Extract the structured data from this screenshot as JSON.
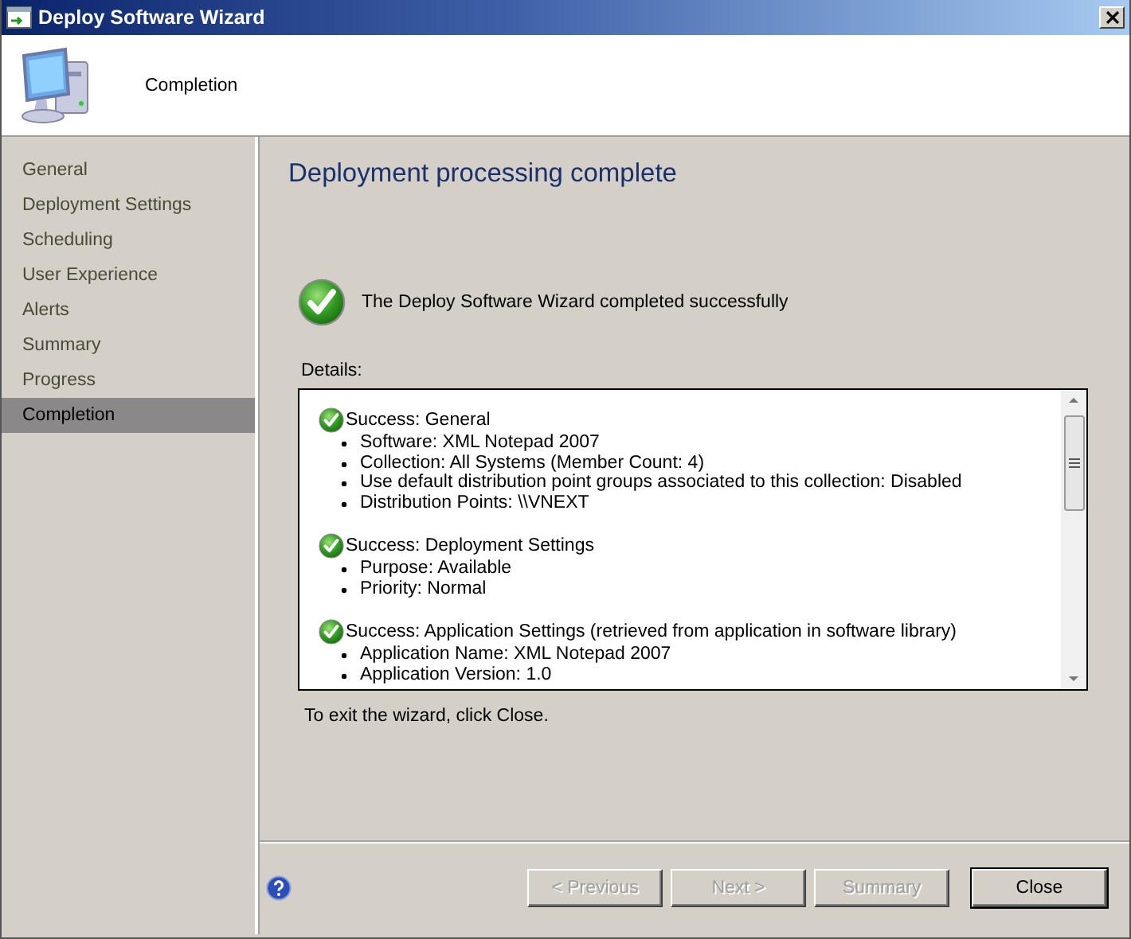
{
  "window": {
    "title": "Deploy Software Wizard"
  },
  "header": {
    "title": "Completion"
  },
  "steps": [
    {
      "label": "General",
      "selected": false
    },
    {
      "label": "Deployment Settings",
      "selected": false
    },
    {
      "label": "Scheduling",
      "selected": false
    },
    {
      "label": "User Experience",
      "selected": false
    },
    {
      "label": "Alerts",
      "selected": false
    },
    {
      "label": "Summary",
      "selected": false
    },
    {
      "label": "Progress",
      "selected": false
    },
    {
      "label": "Completion",
      "selected": true
    }
  ],
  "content": {
    "heading": "Deployment processing complete",
    "status": "The Deploy Software Wizard completed successfully",
    "details_label": "Details:",
    "details": [
      {
        "title": "Success: General",
        "items": [
          "Software: XML Notepad 2007",
          "Collection: All Systems (Member Count: 4)",
          "Use default distribution point groups associated to this collection: Disabled",
          "Distribution Points: \\\\VNEXT"
        ]
      },
      {
        "title": "Success: Deployment Settings",
        "items": [
          "Purpose: Available",
          "Priority: Normal"
        ]
      },
      {
        "title": "Success: Application Settings (retrieved from application in software library)",
        "items": [
          "Application Name: XML Notepad 2007",
          "Application Version: 1.0"
        ]
      }
    ],
    "exit_hint": "To exit the wizard, click Close."
  },
  "buttons": [
    {
      "label": "< Previous",
      "disabled": true,
      "default": false
    },
    {
      "label": "Next >",
      "disabled": true,
      "default": false
    },
    {
      "label": "Summary",
      "disabled": true,
      "default": false
    },
    {
      "label": "Close",
      "disabled": false,
      "default": true
    }
  ]
}
